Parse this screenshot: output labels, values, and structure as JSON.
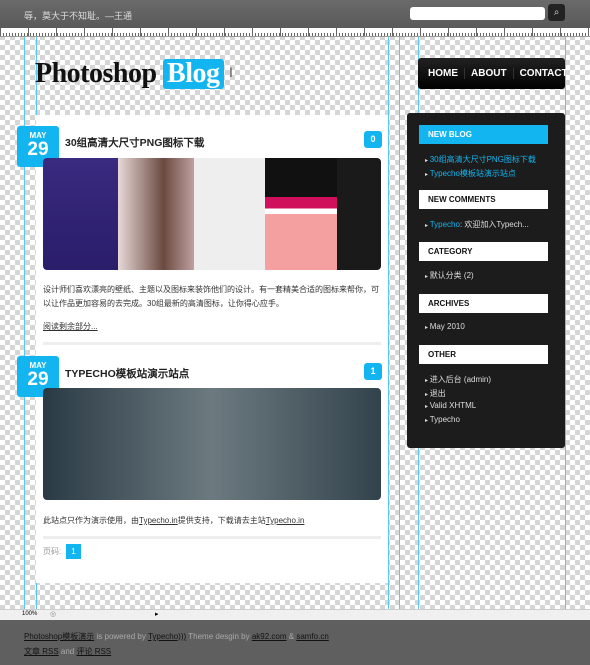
{
  "topbar": {
    "motto": "辱，莫大于不知耻。—王通",
    "search_placeholder": "",
    "search_icon": "search-icon"
  },
  "logo": {
    "text": "Photoshop",
    "highlight": "Blog"
  },
  "nav": [
    "HOME",
    "ABOUT",
    "CONTACT"
  ],
  "posts": [
    {
      "month": "MAY",
      "day": "29",
      "title": "30组高清大尺寸PNG图标下载",
      "comments": "0",
      "excerpt": "设计师们喜欢漂亮的壁纸、主题以及图标来装饰他们的设计。有一套精美合适的图标来帮你，可以让作品更加容易的去完成。30组最新的高清图标，让你得心应手。",
      "read_more": "阅读剩余部分..."
    },
    {
      "month": "MAY",
      "day": "29",
      "title": "TYPECHO模板站演示站点",
      "comments": "1",
      "text_a": "此站点只作为演示使用，由",
      "link_a": "Typecho.in",
      "text_b": "提供支持，下载请去主站",
      "link_b": "Typecho.in"
    }
  ],
  "pager": {
    "label": "页码:",
    "current": "1"
  },
  "sidebar": {
    "new_blog": {
      "title": "NEW BLOG",
      "items": [
        "30组高清大尺寸PNG图标下载",
        "Typecho模板站演示站点"
      ]
    },
    "new_comments": {
      "title": "NEW COMMENTS",
      "author": "Typecho",
      "text": ": 欢迎加入Typech..."
    },
    "category": {
      "title": "CATEGORY",
      "items": [
        "默认分类  (2)"
      ]
    },
    "archives": {
      "title": "ARCHIVES",
      "items": [
        "May 2010"
      ]
    },
    "other": {
      "title": "OTHER",
      "items": [
        "进入后台  (admin)",
        "退出",
        "Valid XHTML",
        "Typecho"
      ]
    }
  },
  "status": {
    "zoom": "100%"
  },
  "footer": {
    "site": "Photoshop模板演示",
    "powered": " is powered by ",
    "typecho": "Typecho)))",
    "design": " Theme desgin by ",
    "d1": "ak92.com",
    "amp": " & ",
    "d2": "samfo.cn",
    "rss1": "文章 RSS",
    "and": " and ",
    "rss2": "评论 RSS"
  },
  "colors": {
    "accent": "#13b5f0",
    "sidebar": "#1c1c1c"
  }
}
